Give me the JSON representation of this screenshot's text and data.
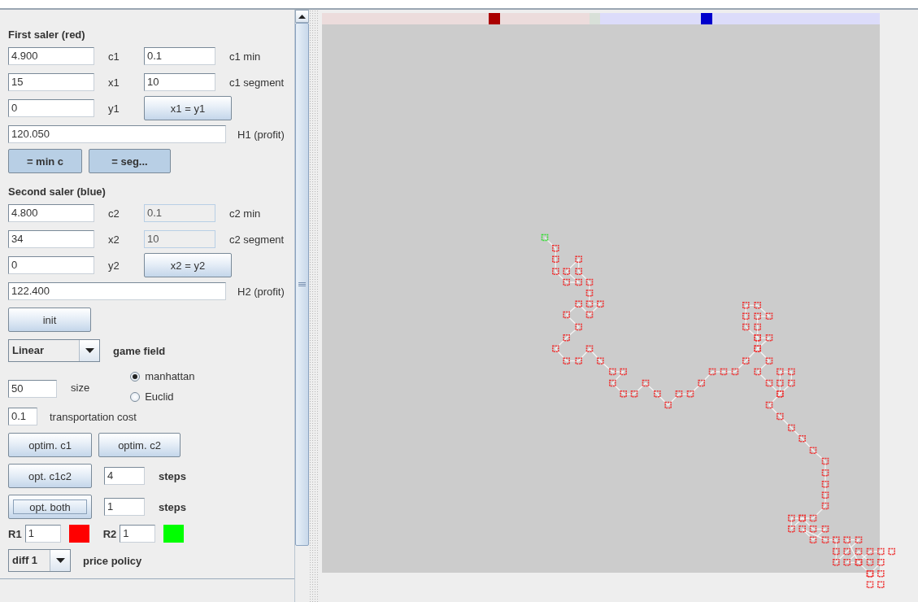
{
  "first_saler": {
    "heading": "First saler (red)",
    "rows": [
      {
        "value": "4.900",
        "label": "c1",
        "extra": {
          "kind": "field",
          "value": "0.1",
          "disabled": false,
          "label": "c1 min"
        }
      },
      {
        "value": "15",
        "label": "x1",
        "extra": {
          "kind": "field",
          "value": "10",
          "disabled": false,
          "label": "c1 segment"
        }
      },
      {
        "value": "0",
        "label": "y1",
        "extra": {
          "kind": "button",
          "label": "x1 = y1"
        }
      }
    ],
    "profit": {
      "value": "120.050",
      "label": "H1 (profit)"
    },
    "buttons": [
      "= min c",
      "= seg..."
    ]
  },
  "second_saler": {
    "heading": "Second saler (blue)",
    "rows": [
      {
        "value": "4.800",
        "label": "c2",
        "extra": {
          "kind": "field",
          "value": "0.1",
          "disabled": true,
          "label": "c2 min"
        }
      },
      {
        "value": "34",
        "label": "x2",
        "extra": {
          "kind": "field",
          "value": "10",
          "disabled": true,
          "label": "c2 segment"
        }
      },
      {
        "value": "0",
        "label": "y2",
        "extra": {
          "kind": "button",
          "label": "x2 = y2"
        }
      }
    ],
    "profit": {
      "value": "122.400",
      "label": "H2 (profit)"
    }
  },
  "init_button": "init",
  "game_field": {
    "value": "Linear",
    "label": "game field"
  },
  "size": {
    "value": "50",
    "label": "size"
  },
  "metric": [
    {
      "label": "manhattan",
      "selected": true
    },
    {
      "label": "Euclid",
      "selected": false
    }
  ],
  "transport_cost": {
    "value": "0.1",
    "label": "transportation cost"
  },
  "optim_buttons": [
    "optim. c1",
    "optim. c2"
  ],
  "opt_rows": [
    {
      "button": "opt. c1c2",
      "focused": false,
      "value": "4",
      "label": "steps"
    },
    {
      "button": "opt. both",
      "focused": true,
      "value": "1",
      "label": "steps"
    }
  ],
  "radii": [
    {
      "label": "R1",
      "value": "1",
      "color": "#ff0000"
    },
    {
      "label": "R2",
      "value": "1",
      "color": "#00ff00"
    }
  ],
  "price_policy": {
    "value": "diff 1",
    "label": "price policy"
  }
}
